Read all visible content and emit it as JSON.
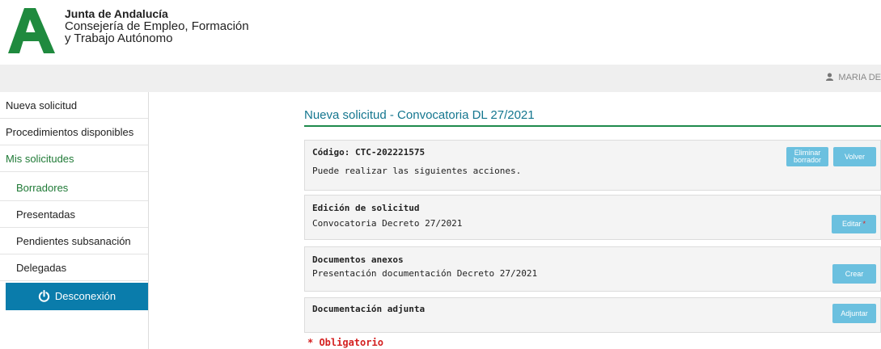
{
  "header": {
    "org_line1": "Junta de Andalucía",
    "org_line2": "Consejería de Empleo, Formación",
    "org_line3": "y Trabajo Autónomo",
    "logo_icon": "junta-andalucia-logo",
    "brand_color": "#1f8a3e"
  },
  "userbar": {
    "user_name": "MARIA DE",
    "user_icon": "user-icon"
  },
  "sidebar": {
    "items": [
      {
        "label": "Nueva solicitud"
      },
      {
        "label": "Procedimientos disponibles"
      },
      {
        "label": "Mis solicitudes"
      },
      {
        "label": "Borradores"
      },
      {
        "label": "Presentadas"
      },
      {
        "label": "Pendientes subsanación"
      },
      {
        "label": "Delegadas"
      }
    ],
    "logout_label": "Desconexión",
    "logout_icon": "power-icon"
  },
  "main": {
    "title": "Nueva solicitud - Convocatoria DL 27/2021",
    "code_panel": {
      "code_label": "Código: CTC-202221575",
      "text": "Puede realizar las siguientes acciones.",
      "delete_label_1": "Eliminar",
      "delete_label_2": "borrador",
      "back_label": "Volver"
    },
    "edit_panel": {
      "heading": "Edición de solicitud",
      "text": "Convocatoria Decreto 27/2021",
      "button_label": "Editar",
      "required_mark": "*"
    },
    "docs_panel": {
      "heading": "Documentos anexos",
      "text": "Presentación documentación Decreto 27/2021",
      "button_label": "Crear"
    },
    "attached_panel": {
      "heading": "Documentación adjunta",
      "button_label": "Adjuntar"
    },
    "required_note": "* Obligatorio"
  },
  "colors": {
    "accent_blue": "#6bc0df",
    "logout_blue": "#0a7cab",
    "title_color": "#14768f",
    "green_text": "#1f7a36",
    "required_red": "#d42020"
  }
}
